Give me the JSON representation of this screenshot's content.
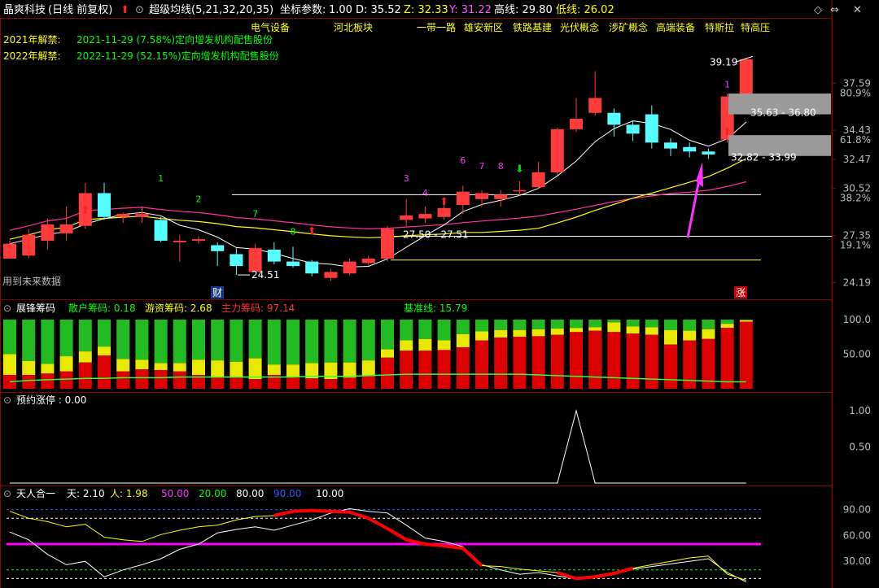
{
  "header": {
    "stock_name": "晶爽科技",
    "period": "(日线 前复权)",
    "indicator": "超级均线(5,21,32,20,35)",
    "coord_label": "坐标参数:",
    "coord_value": "1.00",
    "d_label": "D: 35.52",
    "z_label": "Z: 32.33",
    "y_label": "Y: 31.22",
    "high_label": "高线: 29.80",
    "low_label": "低线: 26.02",
    "colors": {
      "stock_name": "#ffffff",
      "period": "#ffffff",
      "indicator": "#ffffff",
      "d": "#ffffff",
      "z": "#ffff00",
      "y": "#ff55ff",
      "high": "#ffffff",
      "low": "#ffff00"
    }
  },
  "concepts": [
    "电气设备",
    "河北板块",
    "一带一路",
    "雄安新区",
    "铁路基建",
    "光伏概念",
    "涉矿概念",
    "高端装备",
    "特斯拉",
    "特高压"
  ],
  "unlocks": [
    {
      "label": "2021年解禁:",
      "text": "2021-11-29 (7.58%)定向增发机构配售股份"
    },
    {
      "label": "2022年解禁:",
      "text": "2022-11-29 (52.15%)定向增发机构配售股份"
    }
  ],
  "main_notes": {
    "future_data": "用到未来数据",
    "cai": "财",
    "zhang": "涨",
    "max_label": "39.19",
    "min_label": "24.51",
    "zone1": "35.63 - 36.80",
    "zone2": "32.82 - 33.99",
    "zone3": "27.50 - 27.51"
  },
  "main_axis": {
    "ticks": [
      {
        "v": 37.59,
        "pct": "80.9%"
      },
      {
        "v": 34.43,
        "pct": "61.8%"
      },
      {
        "v": 32.47,
        "pct": ""
      },
      {
        "v": 30.52,
        "pct": "38.2%"
      },
      {
        "v": 27.35,
        "pct": "19.1%"
      },
      {
        "v": 24.19,
        "pct": ""
      }
    ],
    "ticks_text": [
      "37.59",
      "34.43",
      "32.47",
      "30.52",
      "27.35",
      "24.19"
    ],
    "pcts_text": [
      "80.9%",
      "61.8%",
      "38.2%",
      "19.1%"
    ]
  },
  "chip_panel": {
    "title": "展锋筹码",
    "retail": "散户筹码: 0.18",
    "hot": "游资筹码: 2.68",
    "main": "主力筹码: 97.14",
    "base": "基准线: 15.79",
    "ticks": [
      "100.0",
      "50.00"
    ]
  },
  "limit_panel": {
    "title": "预约涨停 : 0.00",
    "ticks": [
      "1.00",
      "0.50"
    ]
  },
  "tianren_panel": {
    "title": "天人合一",
    "params": [
      "天: 2.10",
      "人: 1.98",
      "50.00",
      "20.00",
      "80.00",
      "90.00",
      "10.00"
    ],
    "ticks": [
      "90.00",
      "60.00",
      "30.00"
    ]
  },
  "chart_data": {
    "type": "candlestick",
    "y_range": [
      23.5,
      41.0
    ],
    "candles": [
      {
        "o": 25.8,
        "c": 26.8,
        "h": 27.0,
        "l": 25.8
      },
      {
        "o": 26.0,
        "c": 27.4,
        "h": 27.8,
        "l": 25.8
      },
      {
        "o": 27.0,
        "c": 28.1,
        "h": 28.5,
        "l": 26.4
      },
      {
        "o": 27.5,
        "c": 28.1,
        "h": 29.3,
        "l": 27.0
      },
      {
        "o": 28.0,
        "c": 30.2,
        "h": 30.9,
        "l": 27.8
      },
      {
        "o": 30.2,
        "c": 28.6,
        "h": 30.9,
        "l": 28.4
      },
      {
        "o": 28.6,
        "c": 28.8,
        "h": 28.9,
        "l": 28.2
      },
      {
        "o": 28.6,
        "c": 28.8,
        "h": 29.3,
        "l": 28.2
      },
      {
        "o": 28.4,
        "c": 27.0,
        "h": 28.6,
        "l": 26.9
      },
      {
        "o": 26.9,
        "c": 27.0,
        "h": 27.4,
        "l": 25.6
      },
      {
        "o": 27.0,
        "c": 27.1,
        "h": 27.3,
        "l": 26.8
      },
      {
        "o": 26.7,
        "c": 26.3,
        "h": 26.9,
        "l": 25.3
      },
      {
        "o": 26.1,
        "c": 25.3,
        "h": 26.5,
        "l": 24.7
      },
      {
        "o": 24.9,
        "c": 26.5,
        "h": 26.8,
        "l": 24.9
      },
      {
        "o": 26.4,
        "c": 25.6,
        "h": 26.9,
        "l": 25.4
      },
      {
        "o": 25.6,
        "c": 25.3,
        "h": 26.6,
        "l": 25.2
      },
      {
        "o": 25.6,
        "c": 24.8,
        "h": 25.7,
        "l": 24.6
      },
      {
        "o": 24.5,
        "c": 24.9,
        "h": 25.1,
        "l": 24.3
      },
      {
        "o": 24.8,
        "c": 25.6,
        "h": 25.8,
        "l": 24.7
      },
      {
        "o": 25.5,
        "c": 25.8,
        "h": 26.0,
        "l": 25.3
      },
      {
        "o": 25.8,
        "c": 27.8,
        "h": 28.0,
        "l": 25.6
      },
      {
        "o": 28.4,
        "c": 28.7,
        "h": 29.8,
        "l": 27.9
      },
      {
        "o": 28.5,
        "c": 28.8,
        "h": 29.3,
        "l": 28.2
      },
      {
        "o": 28.6,
        "c": 29.2,
        "h": 29.6,
        "l": 28.4
      },
      {
        "o": 29.4,
        "c": 30.3,
        "h": 30.7,
        "l": 28.8
      },
      {
        "o": 29.8,
        "c": 30.2,
        "h": 30.4,
        "l": 29.3
      },
      {
        "o": 29.8,
        "c": 30.1,
        "h": 30.4,
        "l": 29.3
      },
      {
        "o": 30.4,
        "c": 30.4,
        "h": 31.0,
        "l": 30.0
      },
      {
        "o": 30.6,
        "c": 31.6,
        "h": 32.3,
        "l": 30.5
      },
      {
        "o": 31.6,
        "c": 34.5,
        "h": 34.6,
        "l": 31.4
      },
      {
        "o": 34.5,
        "c": 35.2,
        "h": 36.6,
        "l": 34.3
      },
      {
        "o": 35.6,
        "c": 36.6,
        "h": 38.4,
        "l": 35.4
      },
      {
        "o": 35.6,
        "c": 34.8,
        "h": 35.9,
        "l": 34.0
      },
      {
        "o": 34.8,
        "c": 34.2,
        "h": 35.1,
        "l": 33.7
      },
      {
        "o": 35.5,
        "c": 33.6,
        "h": 36.1,
        "l": 33.2
      },
      {
        "o": 33.6,
        "c": 33.2,
        "h": 33.9,
        "l": 32.7
      },
      {
        "o": 33.3,
        "c": 33.0,
        "h": 33.6,
        "l": 32.6
      },
      {
        "o": 33.0,
        "c": 32.8,
        "h": 33.2,
        "l": 32.5
      },
      {
        "o": 33.8,
        "c": 36.7,
        "h": 36.9,
        "l": 33.6
      },
      {
        "o": 36.8,
        "c": 39.2,
        "h": 39.3,
        "l": 36.1
      }
    ],
    "chip_series": {
      "names": [
        "主力筹码",
        "游资筹码",
        "散户筹码"
      ],
      "main": [
        20,
        20,
        22,
        25,
        38,
        48,
        25,
        28,
        27,
        25,
        20,
        17,
        17,
        14,
        20,
        17,
        15,
        14,
        16,
        18,
        45,
        55,
        55,
        56,
        60,
        70,
        74,
        75,
        76,
        78,
        82,
        84,
        82,
        80,
        78,
        64,
        70,
        72,
        88,
        97
      ],
      "hot": [
        30,
        20,
        14,
        22,
        16,
        13,
        18,
        14,
        10,
        12,
        22,
        24,
        22,
        30,
        15,
        18,
        22,
        24,
        22,
        23,
        12,
        15,
        17,
        14,
        19,
        13,
        11,
        10,
        10,
        9,
        6,
        5,
        14,
        10,
        11,
        21,
        14,
        14,
        6,
        2
      ],
      "base": [
        10,
        12,
        13,
        14,
        15,
        15,
        16,
        16,
        16,
        17,
        17,
        17,
        17,
        17,
        17,
        17,
        18,
        18,
        18,
        19,
        20,
        21,
        21,
        21,
        21,
        21,
        21,
        21,
        20,
        19,
        18,
        17,
        16,
        15,
        14,
        13,
        12,
        11,
        10,
        10
      ]
    },
    "limit_series": {
      "name": "预约涨停",
      "values": [
        0,
        0,
        0,
        0,
        0,
        0,
        0,
        0,
        0,
        0,
        0,
        0,
        0,
        0,
        0,
        0,
        0,
        0,
        0,
        0,
        0,
        0,
        0,
        0,
        0,
        0,
        0,
        0,
        0,
        0,
        1,
        0,
        0,
        0,
        0,
        0,
        0,
        0,
        0,
        0
      ]
    },
    "tianren": {
      "levels": [
        90,
        80,
        50,
        20,
        10
      ],
      "tian": [
        88,
        80,
        76,
        70,
        73,
        58,
        55,
        53,
        61,
        66,
        70,
        72,
        78,
        82,
        83,
        88,
        89,
        88,
        87,
        80,
        68,
        55,
        50,
        48,
        45,
        25,
        24,
        21,
        19,
        17,
        10,
        12,
        16,
        22,
        26,
        30,
        34,
        36,
        15,
        8
      ],
      "ren": [
        64,
        55,
        38,
        26,
        30,
        12,
        20,
        26,
        33,
        44,
        50,
        63,
        67,
        70,
        66,
        72,
        78,
        86,
        91,
        88,
        86,
        72,
        57,
        53,
        47,
        26,
        20,
        15,
        17,
        13,
        10,
        13,
        17,
        21,
        24,
        27,
        30,
        33,
        17,
        6
      ]
    }
  }
}
